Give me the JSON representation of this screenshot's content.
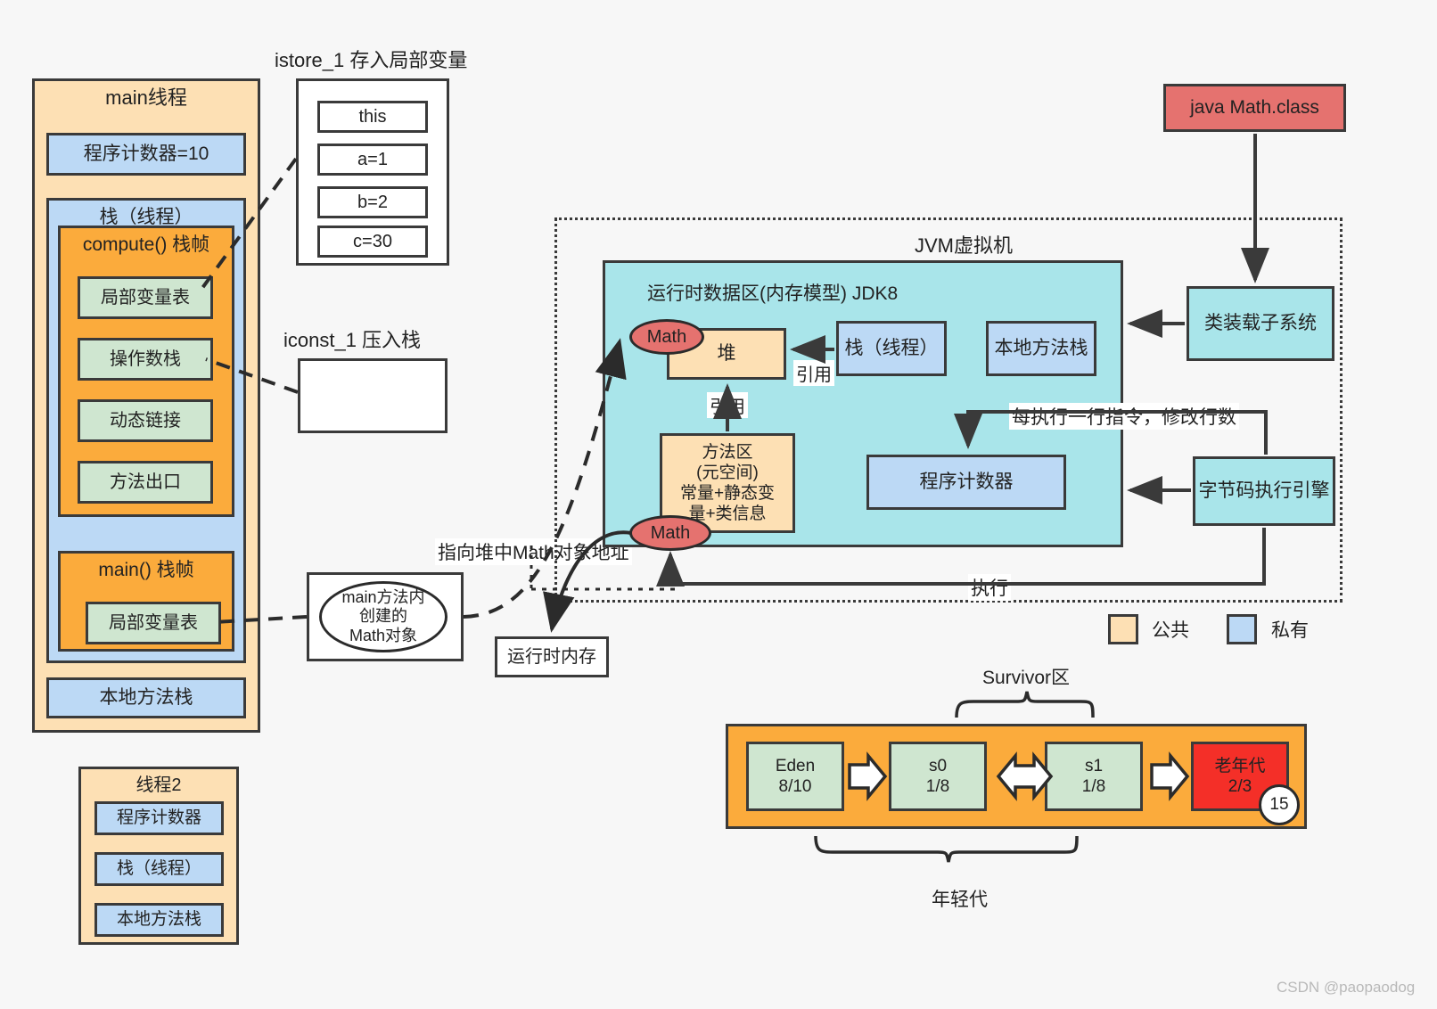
{
  "watermark": "CSDN @paopaodog",
  "main_thread": {
    "title": "main线程",
    "pc": "程序计数器=10",
    "stack_title": "栈（线程）",
    "compute_frame": {
      "title": "compute() 栈帧",
      "slots": [
        "局部变量表",
        "操作数栈",
        "动态链接",
        "方法出口"
      ]
    },
    "main_frame": {
      "title": "main() 栈帧",
      "slots": [
        "局部变量表"
      ]
    },
    "native_stack": "本地方法栈"
  },
  "thread2": {
    "title": "线程2",
    "items": [
      "程序计数器",
      "栈（线程）",
      "本地方法栈"
    ]
  },
  "istore": {
    "caption": "istore_1 存入局部变量",
    "rows": [
      "this",
      "a=1",
      "b=2",
      "c=30"
    ]
  },
  "iconst": {
    "caption": "iconst_1 压入栈",
    "rows": []
  },
  "math_obj_note": {
    "ellipse": "main方法内\n创建的\nMath对象"
  },
  "pointer_label": "指向堆中Math对象地址",
  "runtime_memory": "运行时内存",
  "jvm": {
    "title": "JVM虚拟机",
    "runtime_area": {
      "title": "运行时数据区(内存模型) JDK8",
      "heap": "堆",
      "heap_badge": "Math",
      "stack": "栈（线程）",
      "native_stack": "本地方法栈",
      "method_area": "方法区\n(元空间)\n常量+静态变\n量+类信息",
      "method_area_badge": "Math",
      "pc": "程序计数器",
      "ref_label_1": "引用",
      "ref_label_2": "引用"
    },
    "class_file": "java Math.class",
    "class_loader": "类装载子系统",
    "exec_engine": "字节码执行引擎",
    "modify_line_label": "每执行一行指令，修改行数",
    "execute_label": "执行"
  },
  "legend": {
    "public_color": "#fde0b4",
    "public_label": "公共",
    "private_color": "#bcd9f5",
    "private_label": "私有"
  },
  "heap_gen": {
    "survivor_label": "Survivor区",
    "young_label": "年轻代",
    "cells": [
      {
        "name": "Eden",
        "ratio": "8/10"
      },
      {
        "name": "s0",
        "ratio": "1/8"
      },
      {
        "name": "s1",
        "ratio": "1/8"
      },
      {
        "name": "老年代",
        "ratio": "2/3"
      }
    ],
    "age_badge": "15"
  },
  "colors": {
    "orange_light": "#fde0b4",
    "orange_dark": "#fbab3c",
    "blue_light": "#bcd9f5",
    "green_light": "#cfe6d0",
    "cyan": "#a9e5ea",
    "red": "#e5726f",
    "red_strong": "#f42f28",
    "stroke": "#3a3a3a"
  }
}
